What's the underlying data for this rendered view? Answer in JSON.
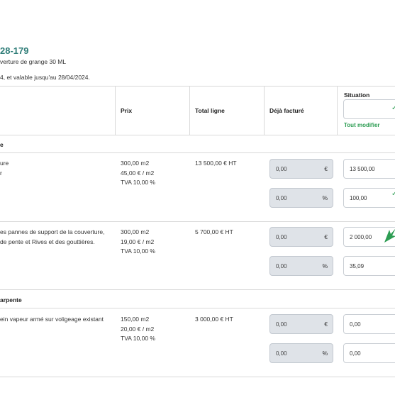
{
  "document": {
    "title": "28-179",
    "subtitle": "verture de grange 30 ML",
    "validity": "4, et valable jusqu'au 28/04/2024."
  },
  "table": {
    "headers": {
      "price": "Prix",
      "line_total": "Total ligne",
      "already_invoiced": "Déjà facturé",
      "situation": "Situation"
    },
    "edit_all": "Tout modifier",
    "sections": [
      {
        "label": "e"
      },
      {
        "label": "arpente"
      }
    ],
    "rows": [
      {
        "desc": [
          "ure",
          "r"
        ],
        "price_lines": [
          "300,00 m2",
          "45,00 € / m2",
          "TVA 10,00 %"
        ],
        "total": "13 500,00 € HT",
        "invoiced_amount": "0,00",
        "invoiced_percent": "0,00",
        "situation_amount": "13 500,00",
        "situation_percent": "100,00"
      },
      {
        "desc": [
          "es pannes de support de la couverture,",
          "de pente et Rives et des gouttières."
        ],
        "price_lines": [
          "300,00 m2",
          "19,00 € / m2",
          "TVA 10,00 %"
        ],
        "total": "5 700,00 € HT",
        "invoiced_amount": "0,00",
        "invoiced_percent": "0,00",
        "situation_amount": "2 000,00",
        "situation_percent": "35,09"
      },
      {
        "desc": [
          "ein vapeur armé sur voligeage existant"
        ],
        "price_lines": [
          "150,00 m2",
          "20,00 € / m2",
          "TVA 10,00 %"
        ],
        "total": "3 000,00 € HT",
        "invoiced_amount": "0,00",
        "invoiced_percent": "0,00",
        "situation_amount": "0,00",
        "situation_percent": "0,00"
      }
    ],
    "units": {
      "euro": "€",
      "percent": "%"
    }
  },
  "colors": {
    "accent": "#2f7d78",
    "green": "#2d9d53",
    "input_gray": "#dfe3e8"
  },
  "icons": [
    "check-icon",
    "cursor-arrow-icon"
  ]
}
